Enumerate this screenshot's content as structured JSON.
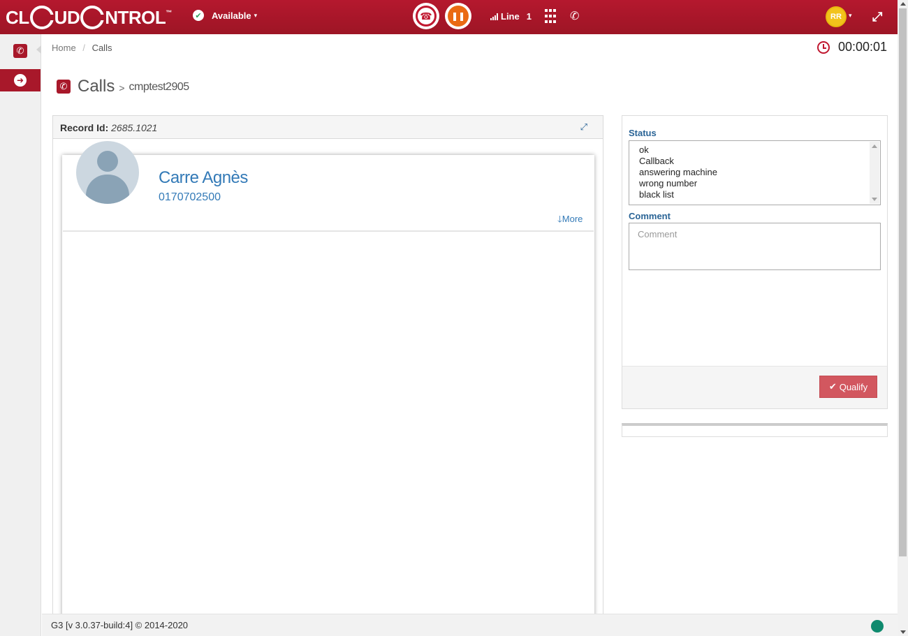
{
  "topbar": {
    "logo_part1": "CL",
    "logo_part2": "UD",
    "logo_part3": "NTROL",
    "logo_tm": "™",
    "status_label": "Available",
    "line_label": "Line",
    "line_number": "1",
    "user_initials": "RR"
  },
  "breadcrumb": {
    "home": "Home",
    "separator": "/",
    "current": "Calls"
  },
  "timer": "00:00:01",
  "page_title": {
    "title": "Calls",
    "separator": ">",
    "campaign": "cmptest2905"
  },
  "record": {
    "label": "Record Id:",
    "id": "2685.1021",
    "contact_name": "Carre Agnès",
    "contact_phone": "0170702500",
    "more_label": "More"
  },
  "qualification": {
    "status_label": "Status",
    "status_options": [
      "ok",
      "Callback",
      "answering machine",
      "wrong number",
      "black list"
    ],
    "comment_label": "Comment",
    "comment_placeholder": "Comment",
    "comment_value": "",
    "qualify_label": "Qualify"
  },
  "footer": {
    "version": "G3 [v 3.0.37-build:4] © 2014-2020"
  },
  "colors": {
    "brand": "#a8182a",
    "pause": "#ea6a13",
    "link": "#337ab7",
    "qualify": "#d2575f",
    "connection": "#0f8a6e",
    "avatar": "#f2c31b"
  },
  "icons": {
    "status": "check-circle-icon",
    "hangup": "hangup-icon",
    "pause": "pause-icon",
    "signal": "signal-icon",
    "keypad": "keypad-icon",
    "transfer": "phone-transfer-icon",
    "fullscreen": "expand-icon",
    "timer": "clock-icon",
    "nav_phone": "phone-icon",
    "nav_toggle": "arrow-right-icon",
    "record_expand": "expand-arrows-icon",
    "more": "arrow-down-icon",
    "qualify": "check-icon"
  }
}
